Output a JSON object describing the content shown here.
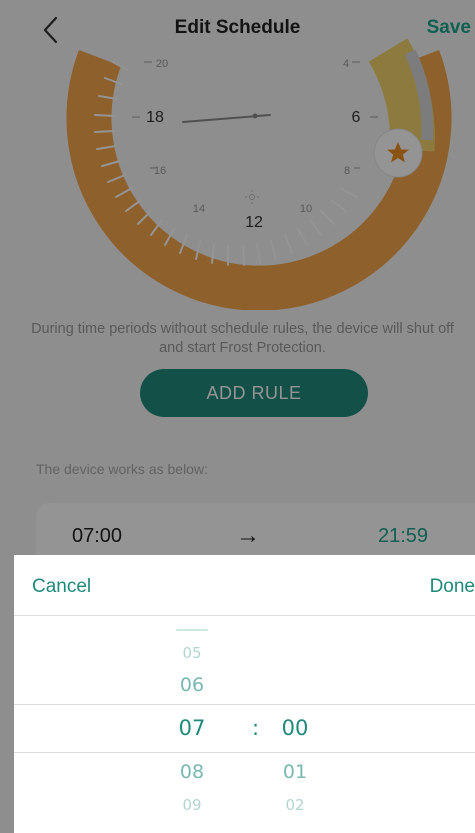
{
  "header": {
    "title": "Edit Schedule",
    "save_label": "Save",
    "back_icon": "chevron-left-icon"
  },
  "dial": {
    "hour_labels_large": [
      "18",
      "6",
      "12"
    ],
    "hour_labels_small": [
      "20",
      "4",
      "16",
      "8",
      "14",
      "10"
    ],
    "marker_icon": "star-icon",
    "colors": {
      "track": "#f4a64a",
      "accent": "#f2d36b",
      "background": "#ffffff"
    }
  },
  "info_text": "During time periods without schedule rules, the device will shut off and start Frost Protection.",
  "add_rule_label": "ADD RULE",
  "works_label": "The device works as below:",
  "rule": {
    "start": "07:00",
    "arrow": "→",
    "end": "21:59"
  },
  "picker": {
    "cancel_label": "Cancel",
    "done_label": "Done",
    "hours": [
      "05",
      "06",
      "07",
      "08",
      "09"
    ],
    "minutes": [
      "00",
      "01",
      "02"
    ],
    "separator": ":",
    "selected_hour": "07",
    "selected_minute": "00"
  },
  "colors": {
    "brand": "#1aa58a",
    "brand_dark": "#1f8a7c"
  }
}
